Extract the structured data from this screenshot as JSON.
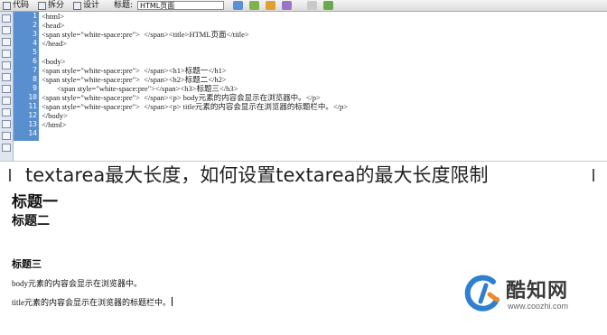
{
  "toolbar": {
    "code_label": "代码",
    "split_label": "拆分",
    "design_label": "设计",
    "title_label": "标题:",
    "title_value": "HTML页面"
  },
  "line_numbers": [
    "1",
    "2",
    "3",
    "4",
    "5",
    "6",
    "7",
    "8",
    "9",
    "10",
    "11",
    "12",
    "13",
    "14"
  ],
  "code_lines": [
    "<html>",
    "<head>",
    "<span style=\"white-space:pre\">  </span><title>HTML页面</title>",
    "</head>",
    "",
    "<body>",
    "<span style=\"white-space:pre\">  </span><h1>标题一</h1>",
    "<span style=\"white-space:pre\">  </span><h2>标题二</h2>",
    "        <span style=\"white-space:pre\"></span><h3>标题三</h3>",
    "<span style=\"white-space:pre\">  </span><p> body元素的内容会显示在浏览器中。</p>",
    "<span style=\"white-space:pre\">  </span><p> title元素的内容会显示在浏览器的标题栏中。</p>",
    "</body>",
    "</html>",
    ""
  ],
  "banner": {
    "text": "textarea最大长度，如何设置textarea的最大长度限制"
  },
  "preview": {
    "h1": "标题一",
    "h2": "标题二",
    "h3": "标题三",
    "p1": "body元素的内容会显示在浏览器中。",
    "p2": "title元素的内容会显示在浏览器的标题栏中。"
  },
  "watermark": {
    "name": "酷知网",
    "url": "www.coozhi.com"
  },
  "icons": [
    "code-view-icon",
    "split-view-icon",
    "design-view-icon",
    "browser-preview-icon",
    "refresh-icon",
    "file-icon",
    "debug-icon",
    "options-icon",
    "check-icon"
  ],
  "colors": {
    "gutter": "#5a8fcf",
    "logo_blue": "#2f7fd0",
    "logo_orange": "#f08a24"
  }
}
